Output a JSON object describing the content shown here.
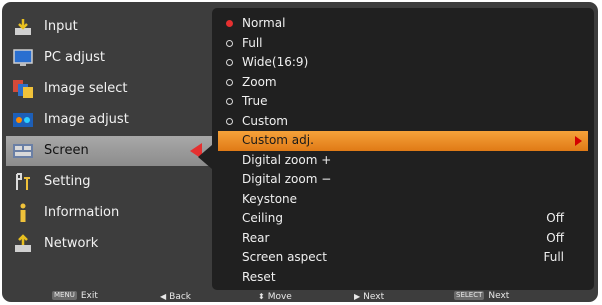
{
  "sidebar": {
    "items": [
      {
        "label": "Input",
        "icon": "input-icon"
      },
      {
        "label": "PC adjust",
        "icon": "pc-adjust-icon"
      },
      {
        "label": "Image select",
        "icon": "image-select-icon"
      },
      {
        "label": "Image adjust",
        "icon": "image-adjust-icon"
      },
      {
        "label": "Screen",
        "icon": "screen-icon",
        "active": true
      },
      {
        "label": "Setting",
        "icon": "setting-icon"
      },
      {
        "label": "Information",
        "icon": "information-icon"
      },
      {
        "label": "Network",
        "icon": "network-icon"
      }
    ]
  },
  "screen_menu": {
    "rows": [
      {
        "label": "Normal",
        "radio": "selected"
      },
      {
        "label": "Full",
        "radio": "unselected"
      },
      {
        "label": "Wide(16:9)",
        "radio": "unselected"
      },
      {
        "label": "Zoom",
        "radio": "unselected"
      },
      {
        "label": "True",
        "radio": "unselected"
      },
      {
        "label": "Custom",
        "radio": "unselected"
      },
      {
        "label": "Custom adj.",
        "highlighted": true,
        "submenu": true
      },
      {
        "label": "Digital zoom +"
      },
      {
        "label": "Digital zoom −"
      },
      {
        "label": "Keystone"
      },
      {
        "label": "Ceiling",
        "value": "Off"
      },
      {
        "label": "Rear",
        "value": "Off"
      },
      {
        "label": "Screen aspect",
        "value": "Full"
      },
      {
        "label": "Reset"
      }
    ]
  },
  "bottom_bar": {
    "exit_key": "MENU",
    "exit_label": "Exit",
    "back_label": "Back",
    "move_label": "Move",
    "next_label": "Next",
    "select_key": "SELECT",
    "select_label": "Next"
  },
  "colors": {
    "background": "#3d3d3d",
    "panel": "#202020",
    "highlight": "#f08a22",
    "active_arrow": "#e53030",
    "radio_selected": "#e53030"
  }
}
